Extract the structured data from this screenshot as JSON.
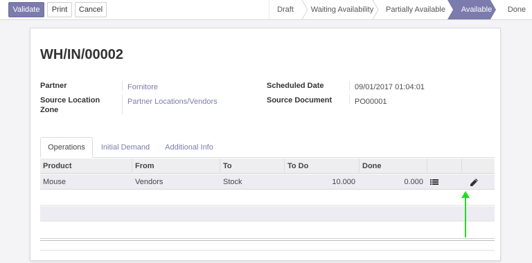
{
  "toolbar": {
    "validate_label": "Validate",
    "print_label": "Print",
    "cancel_label": "Cancel"
  },
  "statusbar": {
    "stages": [
      "Draft",
      "Waiting Availability",
      "Partially Available",
      "Available",
      "Done"
    ],
    "active_stage": "Available"
  },
  "record": {
    "title": "WH/IN/00002",
    "partner_label": "Partner",
    "partner_value": "Fornitore",
    "source_location_label": "Source Location Zone",
    "source_location_value": "Partner Locations/Vendors",
    "scheduled_date_label": "Scheduled Date",
    "scheduled_date_value": "09/01/2017 01:04:01",
    "source_document_label": "Source Document",
    "source_document_value": "PO00001"
  },
  "tabs": [
    {
      "label": "Operations",
      "active": true
    },
    {
      "label": "Initial Demand",
      "active": false
    },
    {
      "label": "Additional Info",
      "active": false
    }
  ],
  "table": {
    "columns": [
      "Product",
      "From",
      "To",
      "To Do",
      "Done"
    ],
    "rows": [
      {
        "product": "Mouse",
        "from": "Vendors",
        "to": "Stock",
        "todo": "10.000",
        "done": "0.000"
      }
    ]
  },
  "icons": {
    "row_detail": "list-icon",
    "row_edit": "pencil-icon",
    "annotation": "arrow-up-icon"
  },
  "colors": {
    "primary": "#7c7bad",
    "annotation_arrow": "#22dd22"
  }
}
